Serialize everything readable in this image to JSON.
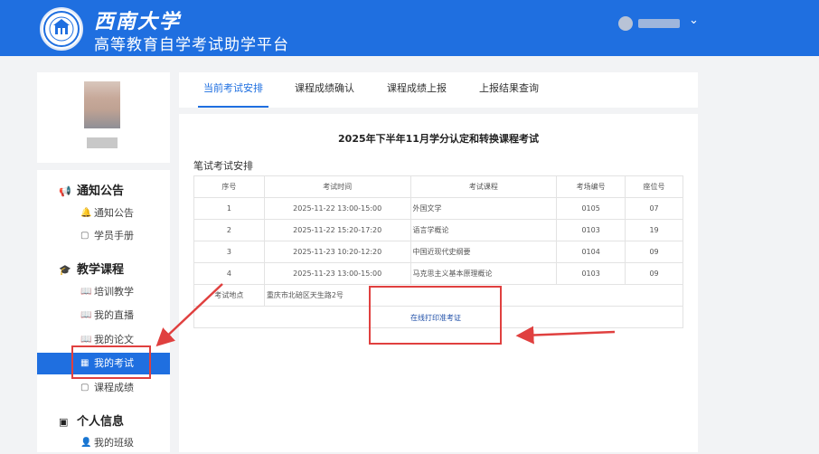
{
  "header": {
    "brand_name": "西南大学",
    "platform_title": "高等教育自学考试助学平台",
    "colors": {
      "primary": "#1f6fe0",
      "highlight": "#e0403f"
    }
  },
  "sidebar": {
    "groups": [
      {
        "label": "通知公告",
        "icon": "megaphone-icon",
        "items": [
          {
            "label": "通知公告",
            "icon": "bell-icon"
          },
          {
            "label": "学员手册",
            "icon": "document-icon"
          }
        ]
      },
      {
        "label": "教学课程",
        "icon": "graduation-cap-icon",
        "items": [
          {
            "label": "培训教学",
            "icon": "book-icon"
          },
          {
            "label": "我的直播",
            "icon": "book-icon"
          },
          {
            "label": "我的论文",
            "icon": "book-icon"
          },
          {
            "label": "我的考试",
            "icon": "grid-icon",
            "active": true
          },
          {
            "label": "课程成绩",
            "icon": "document-icon"
          }
        ]
      },
      {
        "label": "个人信息",
        "icon": "id-card-icon",
        "items": [
          {
            "label": "我的班级",
            "icon": "user-icon"
          }
        ]
      }
    ]
  },
  "tabs": [
    {
      "label": "当前考试安排",
      "active": true
    },
    {
      "label": "课程成绩确认"
    },
    {
      "label": "课程成绩上报"
    },
    {
      "label": "上报结果查询"
    }
  ],
  "content": {
    "title": "2025年下半年11月学分认定和转换课程考试",
    "section_label": "笔试考试安排",
    "table": {
      "headers": [
        "序号",
        "考试时间",
        "考试课程",
        "考场编号",
        "座位号"
      ],
      "rows": [
        [
          "1",
          "2025-11-22 13:00-15:00",
          "外国文学",
          "0105",
          "07"
        ],
        [
          "2",
          "2025-11-22 15:20-17:20",
          "语言学概论",
          "0103",
          "19"
        ],
        [
          "3",
          "2025-11-23 10:20-12:20",
          "中国近现代史纲要",
          "0104",
          "09"
        ],
        [
          "4",
          "2025-11-23 13:00-15:00",
          "马克思主义基本原理概论",
          "0103",
          "09"
        ]
      ],
      "location_label": "考试地点",
      "location_value": "重庆市北碚区天生路2号"
    },
    "print_link": "在线打印准考证"
  }
}
